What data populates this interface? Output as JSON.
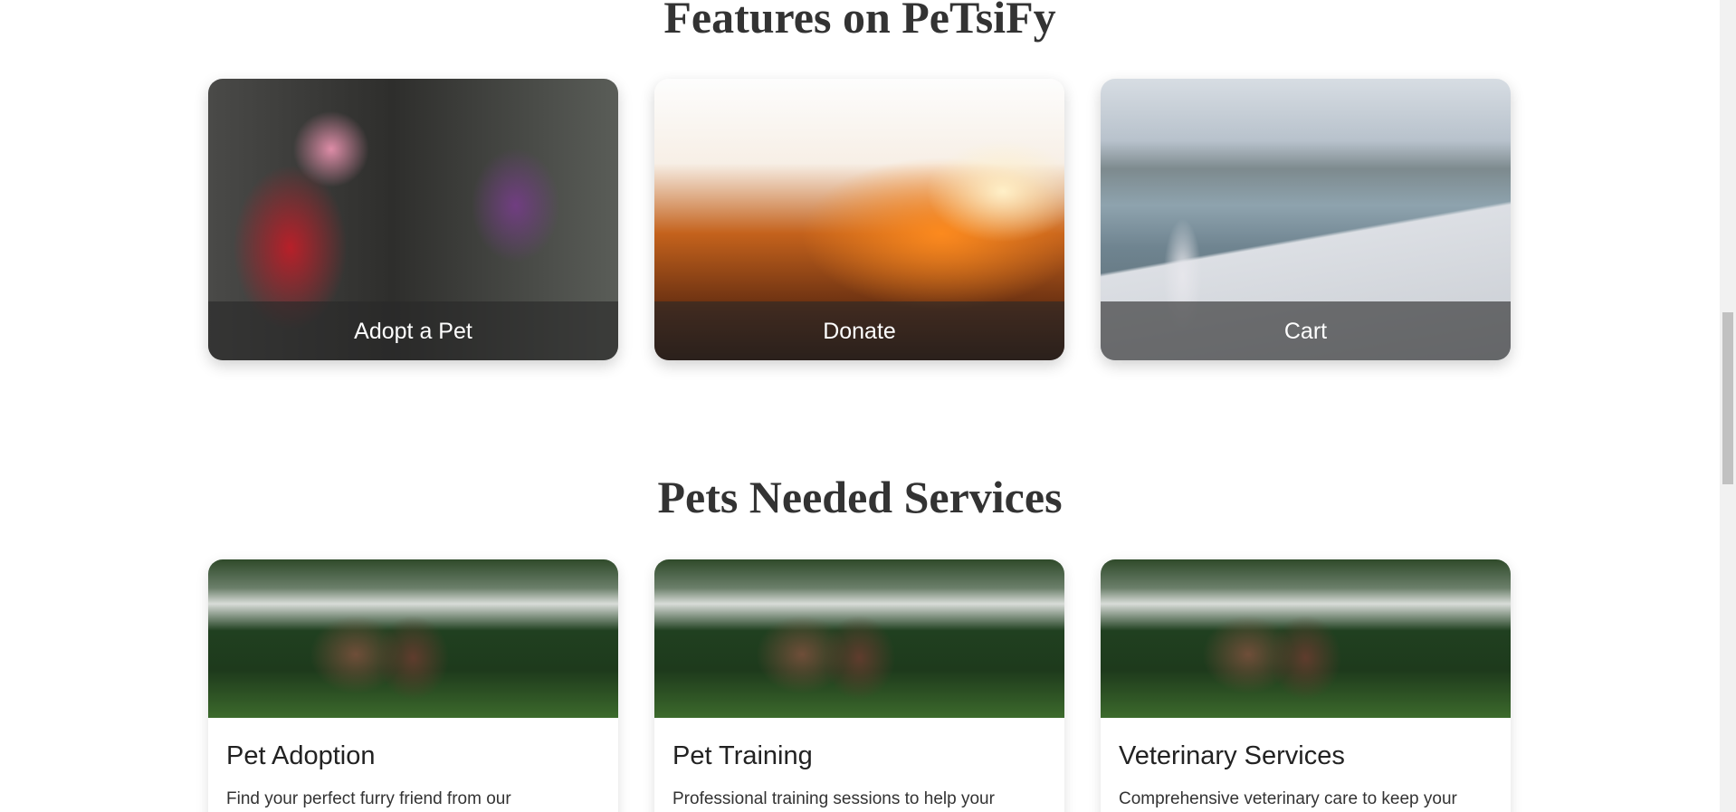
{
  "features": {
    "title": "Features on PeTsiFy",
    "cards": [
      {
        "label": "Adopt a Pet"
      },
      {
        "label": "Donate"
      },
      {
        "label": "Cart"
      }
    ]
  },
  "services": {
    "title": "Pets Needed Services",
    "cards": [
      {
        "title": "Pet Adoption",
        "description": "Find your perfect furry friend from our"
      },
      {
        "title": "Pet Training",
        "description": "Professional training sessions to help your"
      },
      {
        "title": "Veterinary Services",
        "description": "Comprehensive veterinary care to keep your"
      }
    ]
  }
}
